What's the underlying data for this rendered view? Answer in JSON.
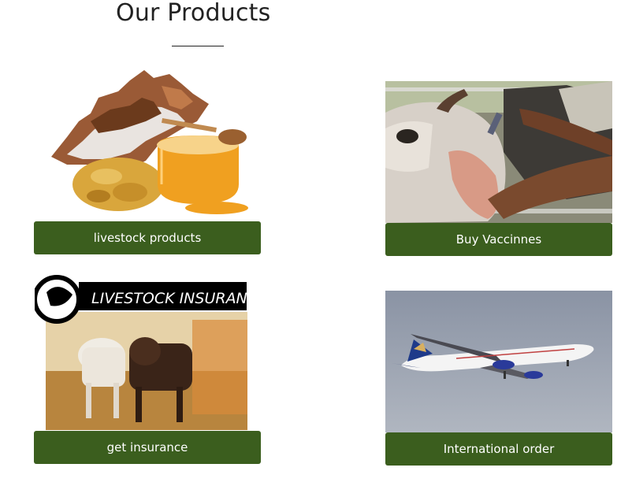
{
  "section": {
    "title": "Our Products"
  },
  "products": [
    {
      "label": "livestock products",
      "image": "cowhide-honey-frankincense-image"
    },
    {
      "label": "Buy Vaccinnes",
      "image": "cow-vaccination-image"
    },
    {
      "label": "get insurance",
      "image": "livestock-insurance-image",
      "image_text": "LIVESTOCK INSURANCE"
    },
    {
      "label": "International order",
      "image": "airplane-image"
    }
  ],
  "colors": {
    "button_bg": "#3b5e1e",
    "button_text": "#ffffff",
    "title_text": "#222222"
  }
}
